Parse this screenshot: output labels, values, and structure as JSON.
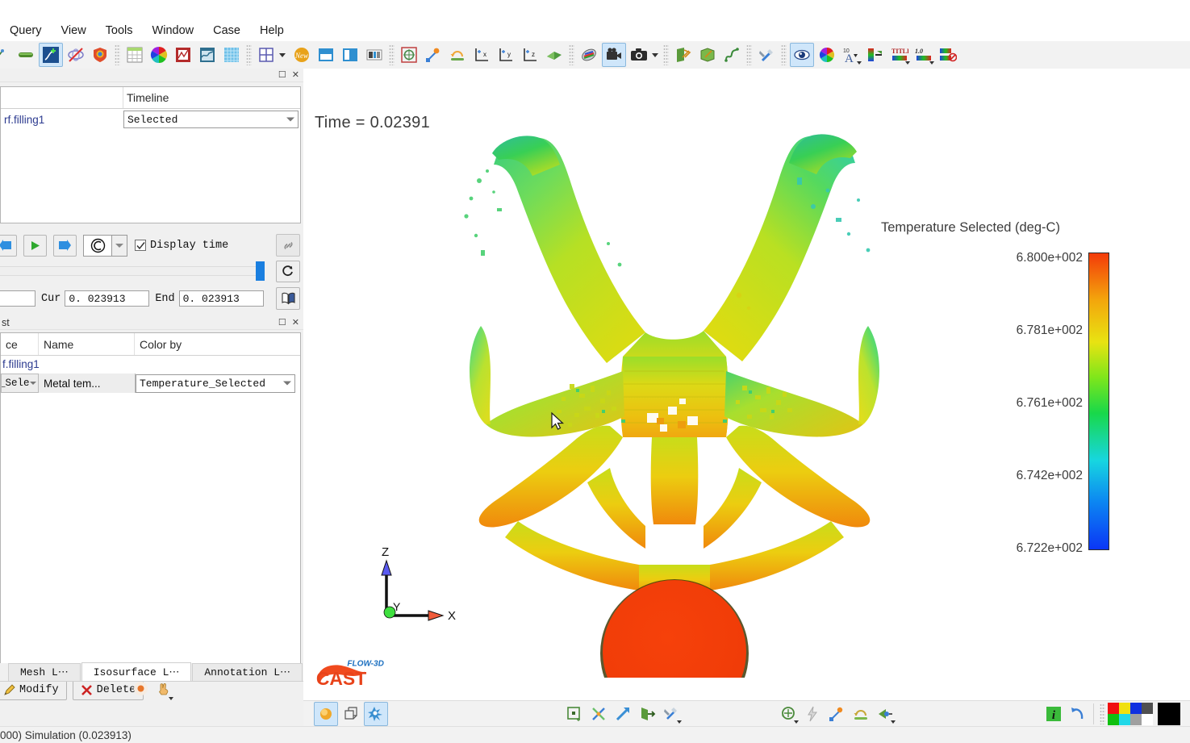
{
  "menu": {
    "items": [
      {
        "label": "Query",
        "name": "menu-query"
      },
      {
        "label": "View",
        "name": "menu-view"
      },
      {
        "label": "Tools",
        "name": "menu-tools"
      },
      {
        "label": "Window",
        "name": "menu-window"
      },
      {
        "label": "Case",
        "name": "menu-case"
      },
      {
        "label": "Help",
        "name": "menu-help"
      }
    ]
  },
  "toolbar": {
    "icons": [
      "particles-icon",
      "green-bar-icon",
      "history-probe-icon",
      "no-streamline-icon",
      "shield-render-icon",
      "spreadsheet-icon",
      "color-wheel-icon",
      "chart-plot-icon",
      "probe-plot-icon",
      "texture-icon",
      "layout-grid-icon",
      "new-window-icon",
      "split-horizontal-icon",
      "split-vertical-icon",
      "panel-layout-icon",
      "zoom-fit-icon",
      "move-object-icon",
      "rotate-icon",
      "axis-x-icon",
      "axis-y-icon",
      "axis-z-icon",
      "clip-plane-icon",
      "render-palette-icon",
      "movie-camera-icon",
      "snapshot-camera-icon",
      "export-data-icon",
      "export-geometry-icon",
      "export-curve-icon",
      "settings-tools-icon",
      "visibility-eye-icon",
      "colormap-wheel-icon",
      "text-annotation-icon",
      "legend-position-icon",
      "title-format-icon",
      "number-format-icon",
      "minmax-limits-icon"
    ]
  },
  "timeline_panel": {
    "title": "",
    "columns": [
      "",
      "Timeline"
    ],
    "row_name": "rf.filling1",
    "timeline_value": "Selected",
    "display_time_label": "Display time",
    "display_time_checked": true,
    "cur_label": "Cur",
    "cur_value": "0. 023913",
    "end_label": "End",
    "end_value": "0. 023913",
    "start_value": ""
  },
  "isosurface_panel": {
    "title": "st",
    "columns": [
      "ce",
      "Name",
      "Color by"
    ],
    "group_label": "f.filling1",
    "row": {
      "type": "_Sele",
      "name": "Metal tem...",
      "color_by": "Temperature_Selected"
    },
    "buttons": {
      "modify": "Modify",
      "delete": "Delete"
    },
    "tabs": [
      {
        "label": "Mesh L⋯",
        "active": false,
        "name": "tab-mesh-list"
      },
      {
        "label": "Isosurface L⋯",
        "active": true,
        "name": "tab-isosurface-list"
      },
      {
        "label": "Annotation L⋯",
        "active": false,
        "name": "tab-annotation-list"
      }
    ]
  },
  "viewport": {
    "time_text": "Time = 0.02391",
    "axes": {
      "x": "X",
      "y": "Y",
      "z": "Z"
    },
    "logo_top": "FLOW-3D",
    "logo_main": "CAST"
  },
  "chart_data": {
    "type": "heatmap",
    "title": "Temperature Selected (deg-C)",
    "legend_title": "Temperature Selected (deg-C)",
    "colorbar_ticks": [
      "6.800e+002",
      "6.781e+002",
      "6.761e+002",
      "6.742e+002",
      "6.722e+002"
    ],
    "colorbar_values": [
      680.0,
      678.1,
      676.1,
      674.2,
      672.2
    ],
    "vmin": 672.2,
    "vmax": 680.0,
    "units": "deg-C",
    "colormap": "blue-cyan-green-yellow-orange-red",
    "time": 0.02391,
    "annotation": "Time = 0.02391"
  },
  "status": {
    "text": "000) Simulation (0.023913)"
  },
  "colors": {
    "accent_blue": "#1a7fe0",
    "hot_red": "#f33b0a",
    "cold_blue": "#0b36f5",
    "link_blue": "#2b3a8f",
    "panel_bg": "#f0f0f0"
  }
}
